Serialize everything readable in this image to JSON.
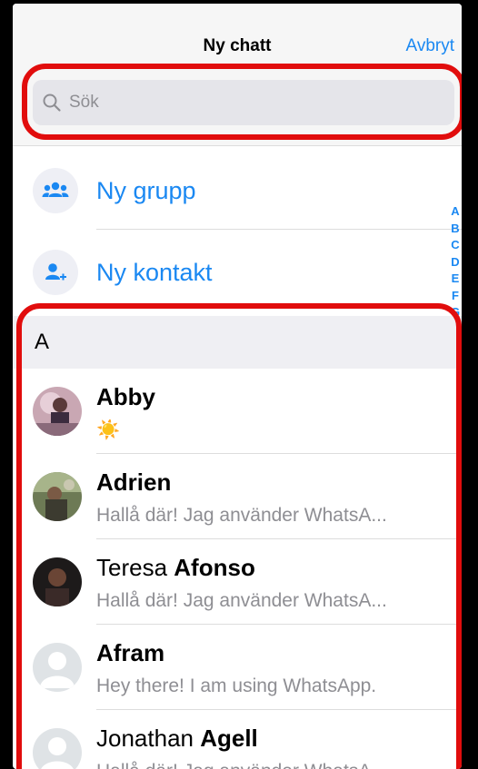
{
  "nav": {
    "title": "Ny chatt",
    "cancel": "Avbryt"
  },
  "search": {
    "placeholder": "Sök"
  },
  "actions": [
    {
      "label": "Ny grupp",
      "icon": "group-icon"
    },
    {
      "label": "Ny kontakt",
      "icon": "add-contact-icon"
    }
  ],
  "index_letters": [
    "A",
    "B",
    "C",
    "D",
    "E",
    "F",
    "G"
  ],
  "section": {
    "letter": "A"
  },
  "contacts": [
    {
      "first": "",
      "last": "Abby",
      "status": "☀️"
    },
    {
      "first": "",
      "last": "Adrien",
      "status": "Hallå där! Jag använder WhatsA..."
    },
    {
      "first": "Teresa",
      "last": "Afonso",
      "status": "Hallå där! Jag använder WhatsA..."
    },
    {
      "first": "",
      "last": "Afram",
      "status": "Hey there! I am using WhatsApp."
    },
    {
      "first": "Jonathan",
      "last": "Agell",
      "status": "Hallå där! Jag använder WhatsA..."
    }
  ],
  "colors": {
    "accent": "#1a88f2",
    "highlight": "#e10d0d",
    "secondary_text": "#8e8e93"
  }
}
